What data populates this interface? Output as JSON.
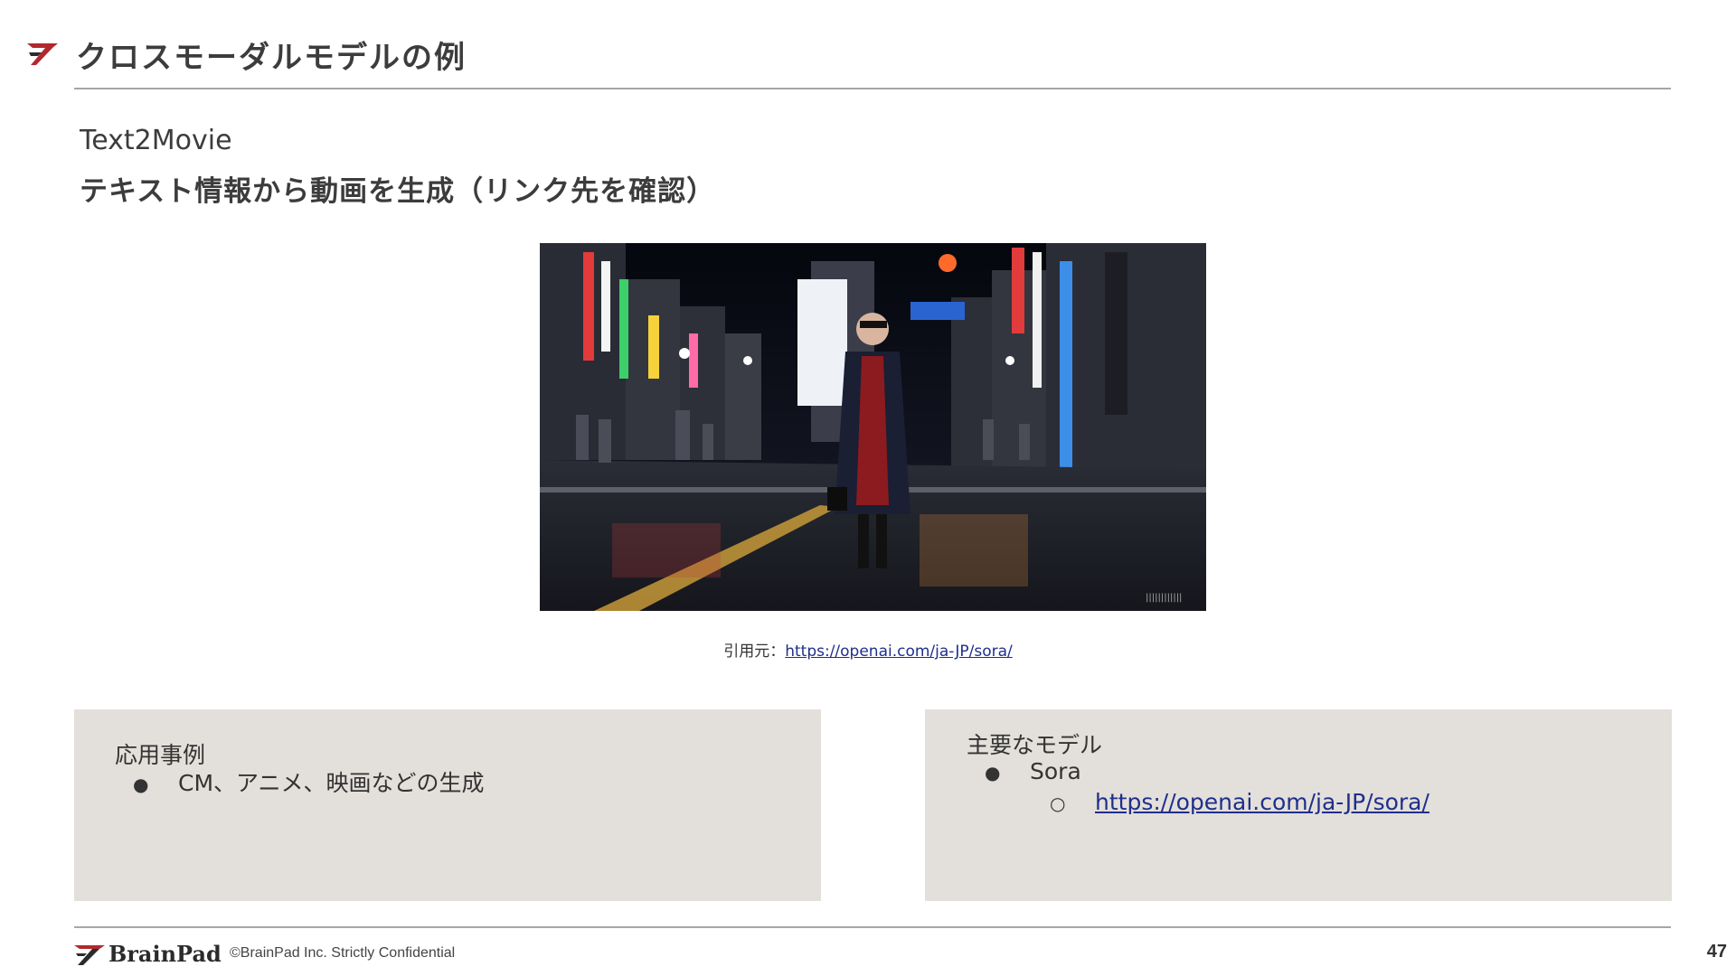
{
  "header": {
    "title": "クロスモーダルモデルの例"
  },
  "subtitle": {
    "line1": "Text2Movie",
    "line2": "テキスト情報から動画を生成（リンク先を確認）"
  },
  "image": {
    "description_icon": "city-night-street-image"
  },
  "caption": {
    "prefix": "引用元：",
    "link": "https://openai.com/ja-JP/sora/"
  },
  "left_panel": {
    "heading": "応用事例",
    "bullet_glyph": "●",
    "items": [
      "CM、アニメ、映画などの生成"
    ]
  },
  "right_panel": {
    "heading": "主要なモデル",
    "bullet_glyph": "●",
    "sub_glyph": "○",
    "item": "Sora",
    "sub_link": "https://openai.com/ja-JP/sora/"
  },
  "footer": {
    "logo_text": "BrainPad",
    "copyright": "©BrainPad Inc.  Strictly Confidential",
    "page_number": "47"
  },
  "colors": {
    "brand_red": "#b3282d",
    "brand_dark": "#2b2b2b",
    "panel_bg": "#e3dfda",
    "link": "#1f2f8c"
  }
}
